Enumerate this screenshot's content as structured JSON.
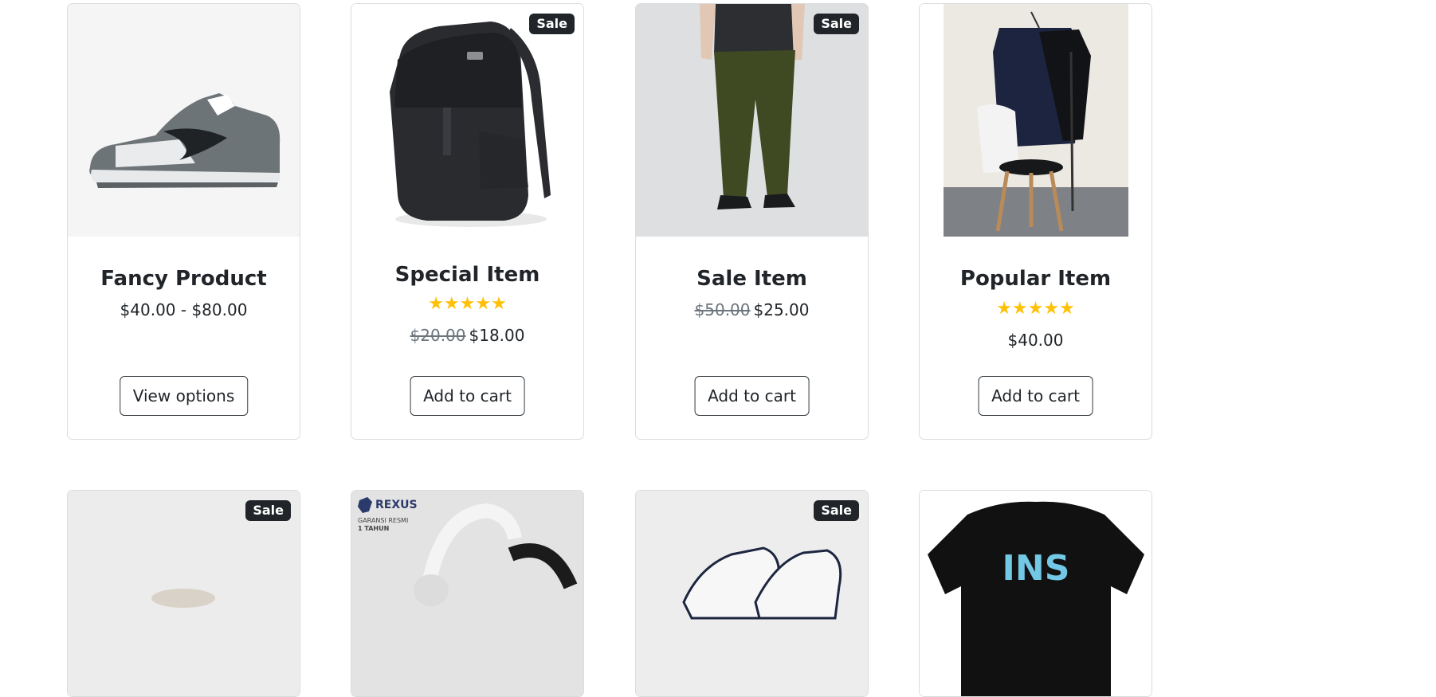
{
  "products": [
    {
      "title": "Fancy Product",
      "price": "$40.00 - $80.00",
      "old_price": "",
      "badge": "",
      "rating": "",
      "button": "View options"
    },
    {
      "title": "Special Item",
      "price": "$18.00",
      "old_price": "$20.00",
      "badge": "Sale",
      "rating": "★★★★★",
      "button": "Add to cart"
    },
    {
      "title": "Sale Item",
      "price": "$25.00",
      "old_price": "$50.00",
      "badge": "Sale",
      "rating": "",
      "button": "Add to cart"
    },
    {
      "title": "Popular Item",
      "price": "$40.00",
      "old_price": "",
      "badge": "",
      "rating": "★★★★★",
      "button": "Add to cart"
    },
    {
      "badge": "Sale"
    },
    {
      "badge": "",
      "brand_text": "REXUS",
      "brand_sub": "GARANSI RESMI",
      "brand_sub2": "1 TAHUN"
    },
    {
      "badge": "Sale"
    },
    {
      "badge": "",
      "shirt_text": "INS"
    }
  ],
  "colors": {
    "badge": "#212529",
    "star": "#ffc107",
    "border": "#d9dce0"
  }
}
